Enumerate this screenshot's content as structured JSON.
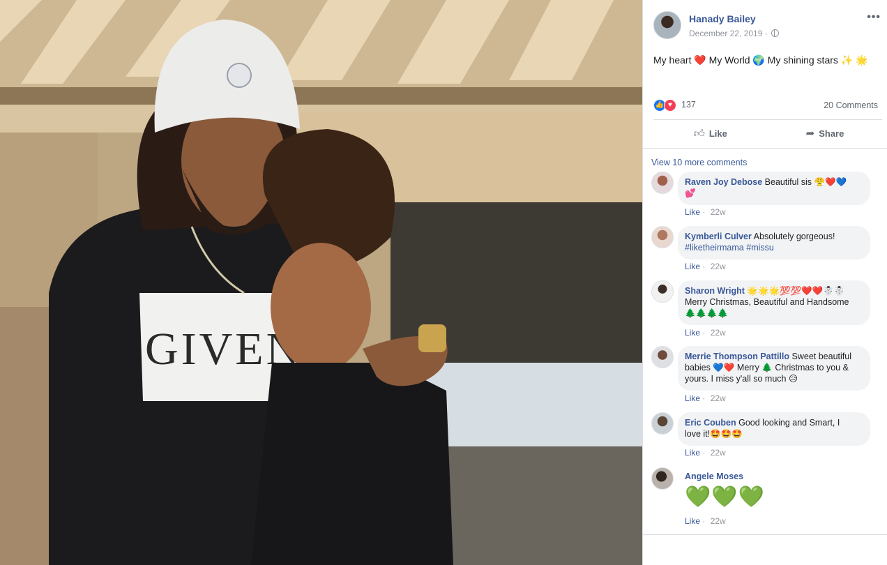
{
  "post": {
    "author": "Hanady Bailey",
    "date": "December 22, 2019 ·",
    "text": "My heart ❤️ My World 🌍 My shining stars ✨ 🌟",
    "reactions_count": "137",
    "comments_count": "20 Comments",
    "like_label": "Like",
    "share_label": "Share",
    "more_label": "•••"
  },
  "comments_section": {
    "view_more": "View 10 more comments",
    "items": [
      {
        "name": "Raven Joy Debose",
        "text": "Beautiful sis 😤❤️💙",
        "text2": "💕",
        "like": "Like",
        "time": "22w"
      },
      {
        "name": "Kymberli Culver",
        "text": "Absolutely gorgeous!",
        "tag1": "#liketheirmama",
        "tag2": "#missu",
        "like": "Like",
        "time": "22w"
      },
      {
        "name": "Sharon Wright",
        "text": "🌟🌟🌟💯💯❤️❤️☃️☃️",
        "line2": "Merry Christmas, Beautiful and Handsome",
        "line3": "🌲🌲🌲🌲",
        "like": "Like",
        "time": "22w"
      },
      {
        "name": "Merrie Thompson Pattillo",
        "text": "Sweet beautiful",
        "line2": "babies 💙❤️ Merry 🌲 Christmas to you &",
        "line3": "yours. I miss y'all so much 😥",
        "like": "Like",
        "time": "22w"
      },
      {
        "name": "Eric Couben",
        "text": "Good looking and Smart, I",
        "line2": "love it!🤩🤩🤩",
        "like": "Like",
        "time": "22w"
      },
      {
        "name": "Angele Moses",
        "hearts": "💚💚💚",
        "like": "Like",
        "time": "22w"
      }
    ]
  },
  "photo": {
    "sweater_text": "GIVENC"
  },
  "colors": {
    "link": "#385898",
    "bubble": "#f2f3f5",
    "meta": "#90949c"
  }
}
